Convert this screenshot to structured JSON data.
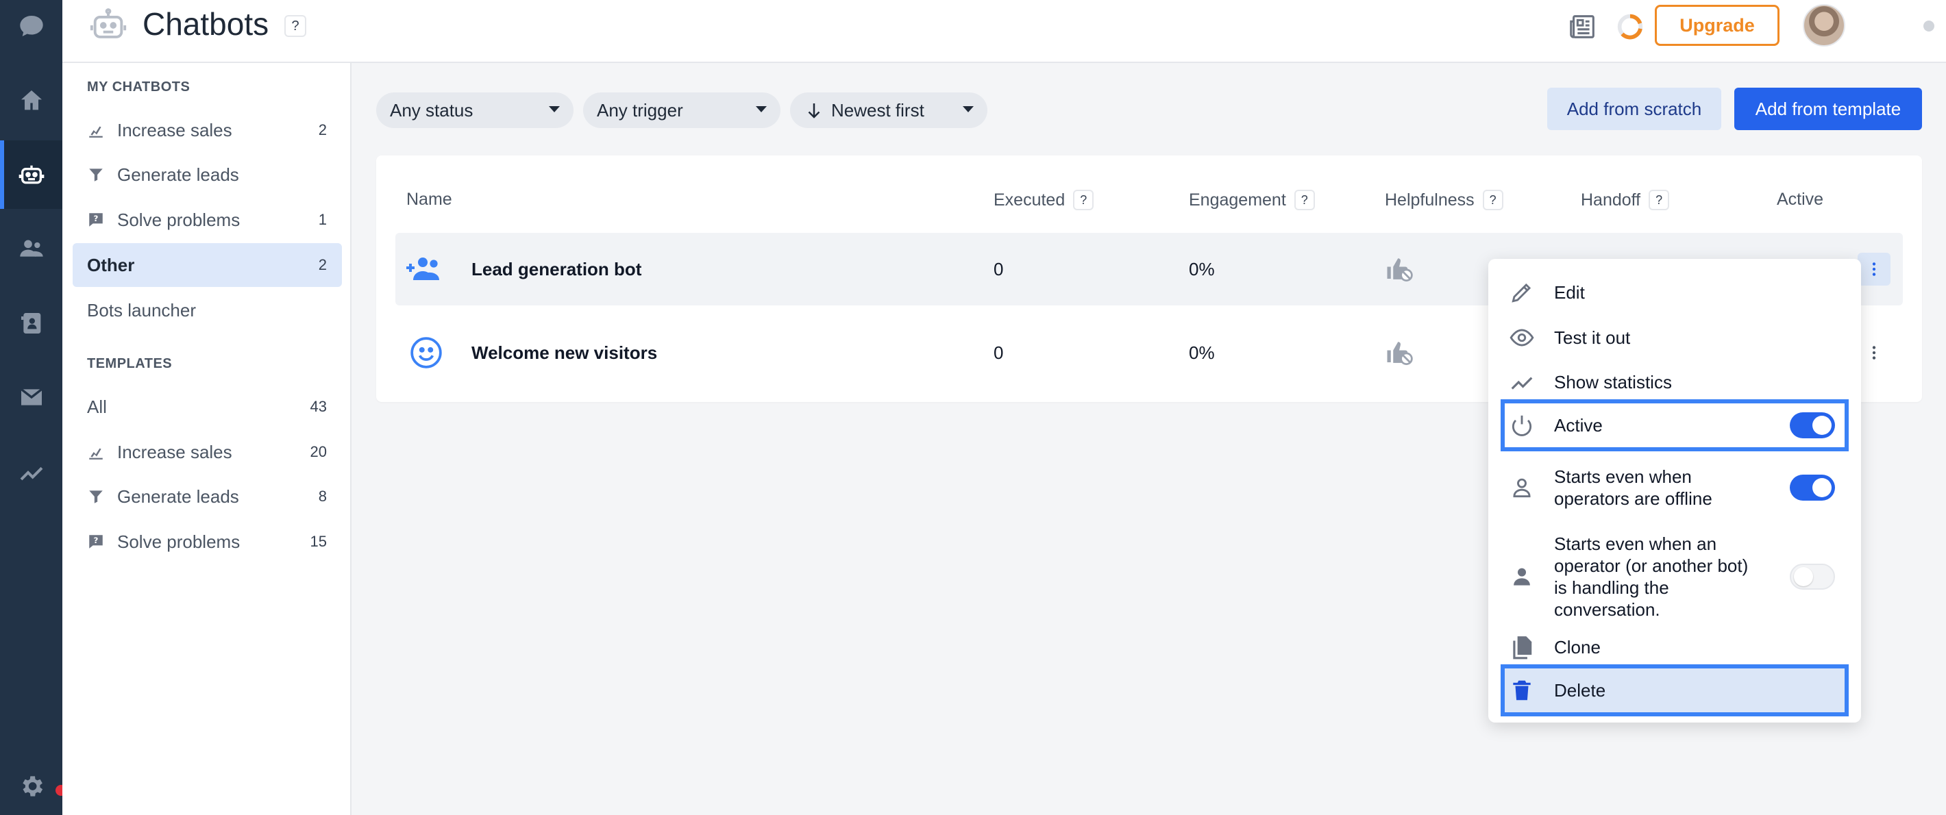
{
  "app": {
    "title": "Chatbots",
    "title_help": "?",
    "upgrade_label": "Upgrade"
  },
  "rail": {
    "items": [
      "chat-icon",
      "home-icon",
      "chatbot-icon",
      "customers-icon",
      "contacts-icon",
      "inbox-icon",
      "reports-icon",
      "settings-icon"
    ],
    "active": "chatbot-icon"
  },
  "sidebar": {
    "my_chatbots_heading": "MY CHATBOTS",
    "my_chatbots": [
      {
        "label": "Increase sales",
        "count": "2",
        "icon": "chart-hand-icon"
      },
      {
        "label": "Generate leads",
        "count": "",
        "icon": "funnel-icon"
      },
      {
        "label": "Solve problems",
        "count": "1",
        "icon": "chat-question-icon"
      },
      {
        "label": "Other",
        "count": "2",
        "icon": ""
      },
      {
        "label": "Bots launcher",
        "count": "",
        "icon": ""
      }
    ],
    "templates_heading": "TEMPLATES",
    "templates": [
      {
        "label": "All",
        "count": "43",
        "icon": ""
      },
      {
        "label": "Increase sales",
        "count": "20",
        "icon": "chart-hand-icon"
      },
      {
        "label": "Generate leads",
        "count": "8",
        "icon": "funnel-icon"
      },
      {
        "label": "Solve problems",
        "count": "15",
        "icon": "chat-question-icon"
      }
    ]
  },
  "filters": {
    "status": "Any status",
    "trigger": "Any trigger",
    "sort": "Newest first"
  },
  "actions": {
    "add_scratch": "Add from scratch",
    "add_template": "Add from template"
  },
  "table": {
    "columns": {
      "name": "Name",
      "executed": "Executed",
      "engagement": "Engagement",
      "helpfulness": "Helpfulness",
      "handoff": "Handoff",
      "active": "Active"
    },
    "help": "?",
    "rows": [
      {
        "name": "Lead generation bot",
        "executed": "0",
        "engagement": "0%",
        "icon": "add-group-icon"
      },
      {
        "name": "Welcome new visitors",
        "executed": "0",
        "engagement": "0%",
        "icon": "smiley-icon"
      }
    ]
  },
  "menu": {
    "edit": "Edit",
    "test": "Test it out",
    "stats": "Show statistics",
    "active": "Active",
    "active_on": true,
    "offline": "Starts even when operators are offline",
    "offline_on": true,
    "handling": "Starts even when an operator (or another bot) is handling the conversation.",
    "handling_on": false,
    "clone": "Clone",
    "delete": "Delete"
  },
  "colors": {
    "accent": "#2563eb",
    "rail": "#223347",
    "upgrade": "#f08a24",
    "highlight": "#3b82f6",
    "notification": "#e22f3a"
  }
}
